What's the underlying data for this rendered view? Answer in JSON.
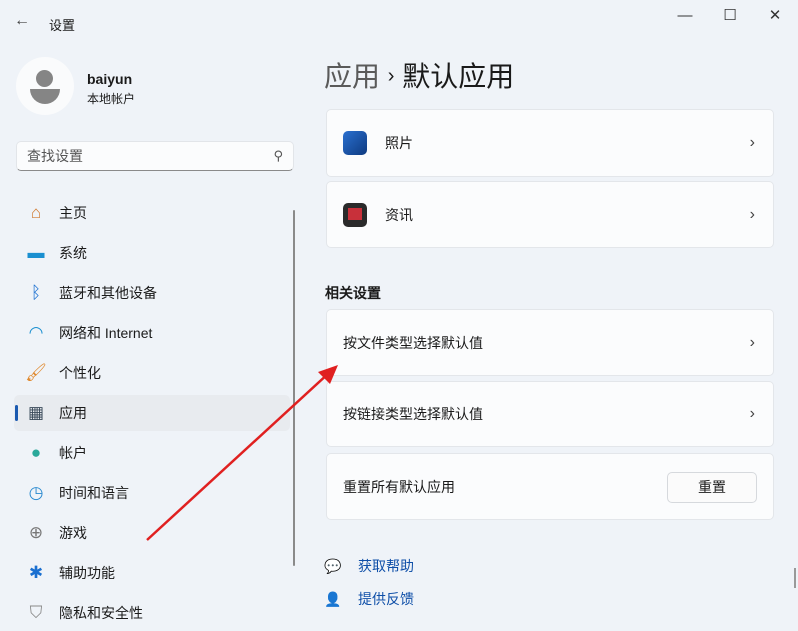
{
  "window": {
    "title": "设置",
    "minimize": "—",
    "maximize": "☐",
    "close": "✕"
  },
  "user": {
    "name": "baiyun",
    "type": "本地帐户"
  },
  "search": {
    "placeholder": "查找设置"
  },
  "nav": [
    {
      "label": "主页",
      "icon": "home-icon"
    },
    {
      "label": "系统",
      "icon": "system-icon"
    },
    {
      "label": "蓝牙和其他设备",
      "icon": "bluetooth-icon"
    },
    {
      "label": "网络和 Internet",
      "icon": "wifi-icon"
    },
    {
      "label": "个性化",
      "icon": "brush-icon"
    },
    {
      "label": "应用",
      "icon": "apps-icon",
      "selected": true
    },
    {
      "label": "帐户",
      "icon": "account-icon"
    },
    {
      "label": "时间和语言",
      "icon": "clock-globe-icon"
    },
    {
      "label": "游戏",
      "icon": "gamepad-icon"
    },
    {
      "label": "辅助功能",
      "icon": "accessibility-icon"
    },
    {
      "label": "隐私和安全性",
      "icon": "shield-icon"
    }
  ],
  "breadcrumb": {
    "parent": "应用",
    "sep": "›",
    "current": "默认应用"
  },
  "apps": [
    {
      "label": "照片",
      "color": "#1f5cb8"
    },
    {
      "label": "资讯",
      "color": "#c8303a"
    }
  ],
  "related": {
    "title": "相关设置",
    "file_type": "按文件类型选择默认值",
    "link_type": "按链接类型选择默认值",
    "reset_label": "重置所有默认应用",
    "reset_button": "重置"
  },
  "links": {
    "help": "获取帮助",
    "feedback": "提供反馈"
  },
  "annotation_color": "#e02020"
}
